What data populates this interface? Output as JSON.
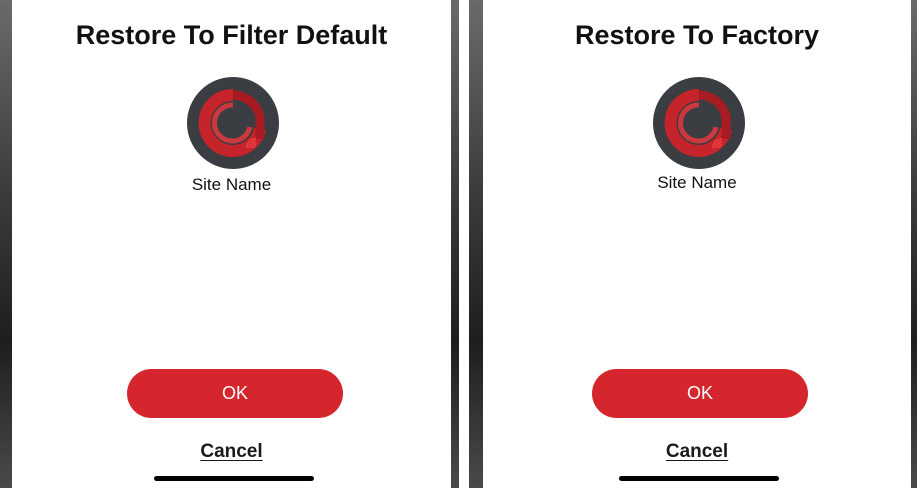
{
  "dialogs": [
    {
      "title": "Restore To Filter Default",
      "site_name": "Site Name",
      "ok_label": "OK",
      "cancel_label": "Cancel",
      "logo_icon": "app-logo-icon"
    },
    {
      "title": "Restore To Factory",
      "site_name": "Site Name",
      "ok_label": "OK",
      "cancel_label": "Cancel",
      "logo_icon": "app-logo-icon"
    }
  ],
  "colors": {
    "accent": "#d4262c",
    "logo_background": "#3a3d42",
    "text": "#111111"
  }
}
